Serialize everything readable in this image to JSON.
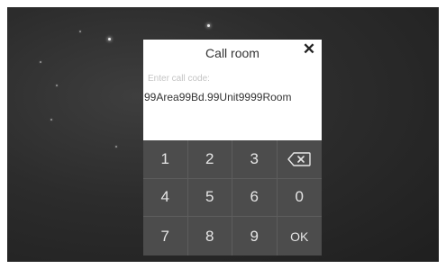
{
  "dialog": {
    "title": "Call room",
    "close_label": "✕",
    "placeholder": "Enter call code:",
    "code_value": "99Area99Bd.99Unit9999Room"
  },
  "keypad": {
    "keys": [
      "1",
      "2",
      "3",
      "⌫",
      "4",
      "5",
      "6",
      "0",
      "7",
      "8",
      "9",
      "OK"
    ]
  },
  "icons": {
    "backspace": "backspace-icon",
    "close": "close-icon"
  }
}
